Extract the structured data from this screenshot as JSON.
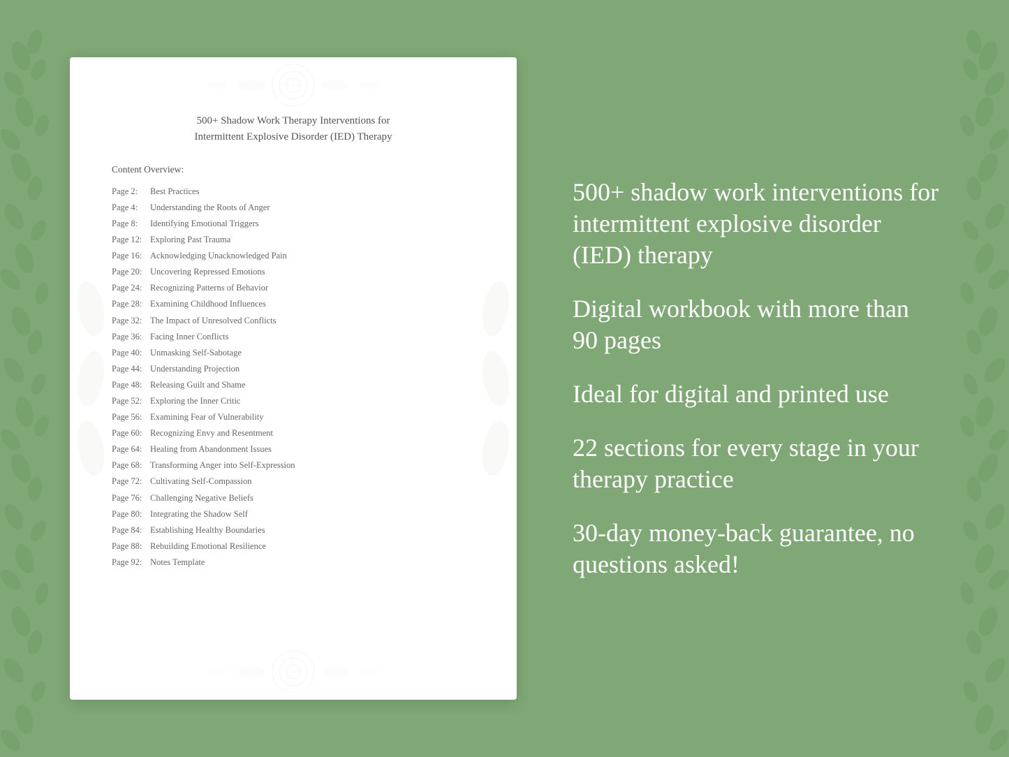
{
  "background": {
    "color": "#7fa876"
  },
  "document": {
    "title_line1": "500+ Shadow Work Therapy Interventions for",
    "title_line2": "Intermittent Explosive Disorder (IED) Therapy",
    "content_overview_label": "Content Overview:",
    "toc_entries": [
      {
        "page": "Page  2:",
        "title": "Best Practices"
      },
      {
        "page": "Page  4:",
        "title": "Understanding the Roots of Anger"
      },
      {
        "page": "Page  8:",
        "title": "Identifying Emotional Triggers"
      },
      {
        "page": "Page 12:",
        "title": "Exploring Past Trauma"
      },
      {
        "page": "Page 16:",
        "title": "Acknowledging Unacknowledged Pain"
      },
      {
        "page": "Page 20:",
        "title": "Uncovering Repressed Emotions"
      },
      {
        "page": "Page 24:",
        "title": "Recognizing Patterns of Behavior"
      },
      {
        "page": "Page 28:",
        "title": "Examining Childhood Influences"
      },
      {
        "page": "Page 32:",
        "title": "The Impact of Unresolved Conflicts"
      },
      {
        "page": "Page 36:",
        "title": "Facing Inner Conflicts"
      },
      {
        "page": "Page 40:",
        "title": "Unmasking Self-Sabotage"
      },
      {
        "page": "Page 44:",
        "title": "Understanding Projection"
      },
      {
        "page": "Page 48:",
        "title": "Releasing Guilt and Shame"
      },
      {
        "page": "Page 52:",
        "title": "Exploring the Inner Critic"
      },
      {
        "page": "Page 56:",
        "title": "Examining Fear of Vulnerability"
      },
      {
        "page": "Page 60:",
        "title": "Recognizing Envy and Resentment"
      },
      {
        "page": "Page 64:",
        "title": "Healing from Abandonment Issues"
      },
      {
        "page": "Page 68:",
        "title": "Transforming Anger into Self-Expression"
      },
      {
        "page": "Page 72:",
        "title": "Cultivating Self-Compassion"
      },
      {
        "page": "Page 76:",
        "title": "Challenging Negative Beliefs"
      },
      {
        "page": "Page 80:",
        "title": "Integrating the Shadow Self"
      },
      {
        "page": "Page 84:",
        "title": "Establishing Healthy Boundaries"
      },
      {
        "page": "Page 88:",
        "title": "Rebuilding Emotional Resilience"
      },
      {
        "page": "Page 92:",
        "title": "Notes Template"
      }
    ]
  },
  "marketing": {
    "points": [
      "500+ shadow work interventions for intermittent explosive disorder (IED) therapy",
      "Digital workbook with more than 90 pages",
      "Ideal for digital and printed use",
      "22 sections for every stage in your therapy practice",
      "30-day money-back guarantee, no questions asked!"
    ]
  }
}
